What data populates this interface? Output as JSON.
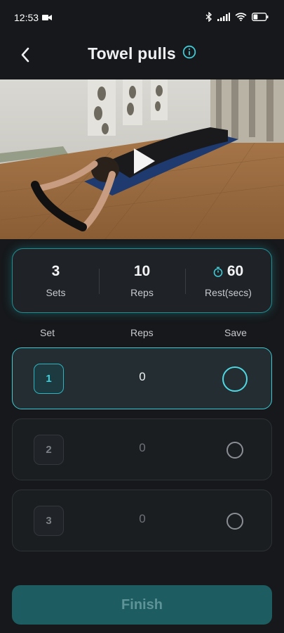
{
  "status": {
    "time": "12:53",
    "battery_level": 0.35
  },
  "header": {
    "title": "Towel pulls",
    "back_icon": "chevron-left-icon",
    "info_icon": "info-icon"
  },
  "video": {
    "thumbnail": "man lying prone on blue mat holding towel",
    "play_icon": "play-icon"
  },
  "stats": {
    "sets_value": "3",
    "sets_label": "Sets",
    "reps_value": "10",
    "reps_label": "Reps",
    "rest_value": "60",
    "rest_label": "Rest(secs)",
    "rest_icon": "timer-icon"
  },
  "columns": {
    "set": "Set",
    "reps": "Reps",
    "save": "Save"
  },
  "rows": [
    {
      "set": "1",
      "reps": "0",
      "active": true
    },
    {
      "set": "2",
      "reps": "0",
      "active": false
    },
    {
      "set": "3",
      "reps": "0",
      "active": false
    }
  ],
  "finish_label": "Finish",
  "colors": {
    "accent": "#3ec9d4",
    "background": "#16181b",
    "finish_bg": "#1d5d61"
  }
}
